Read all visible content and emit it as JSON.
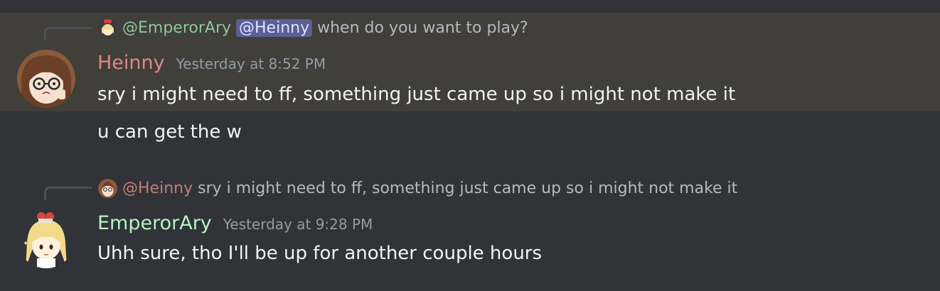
{
  "messages": [
    {
      "reply": {
        "author": "@EmperorAry",
        "mention": "@Heinny",
        "text": "when do you want to play?"
      },
      "author": "Heinny",
      "timestamp": "Yesterday at 8:52 PM",
      "lines": [
        "sry i might need to ff, something just came up so i might not make it",
        "u can get the w"
      ]
    },
    {
      "reply": {
        "author": "@Heinny",
        "text": "sry i might need to ff, something just came up so i might not make it"
      },
      "author": "EmperorAry",
      "timestamp": "Yesterday at 9:28 PM",
      "lines": [
        "Uhh sure, tho I'll be up for another couple hours"
      ]
    }
  ],
  "colors": {
    "background": "#313338",
    "highlight": "#403f39",
    "heinny_name": "#e0867f",
    "emperor_name": "#b8f2c4",
    "emperor_reply_name": "#8ec69e",
    "heinny_reply_name": "#c47c77",
    "mention_bg": "#5b5f96"
  },
  "icons": {
    "heinny_avatar": "anime-girl-glasses-avatar",
    "emperor_avatar": "anime-blonde-girl-avatar"
  }
}
